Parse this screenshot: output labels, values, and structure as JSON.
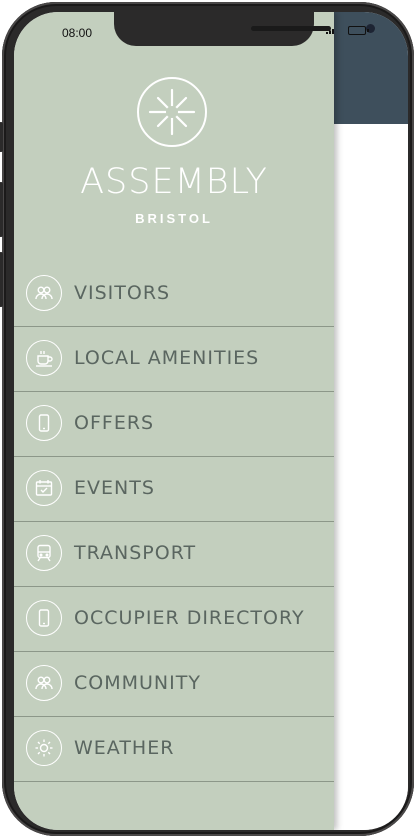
{
  "status_bar": {
    "time": "08:00"
  },
  "brand": {
    "name": "ASSEMBLY",
    "city": "BRISTOL"
  },
  "menu": {
    "items": [
      {
        "label": "VISITORS",
        "icon": "people-icon"
      },
      {
        "label": "LOCAL AMENITIES",
        "icon": "coffee-cup-icon"
      },
      {
        "label": "OFFERS",
        "icon": "phone-icon"
      },
      {
        "label": "EVENTS",
        "icon": "calendar-icon"
      },
      {
        "label": "TRANSPORT",
        "icon": "train-icon"
      },
      {
        "label": "OCCUPIER DIRECTORY",
        "icon": "phone-icon"
      },
      {
        "label": "COMMUNITY",
        "icon": "people-icon"
      },
      {
        "label": "WEATHER",
        "icon": "sun-icon"
      }
    ]
  },
  "colors": {
    "drawer": "#c3cfbe",
    "header": "#3e4f5c",
    "text": "#5a6660",
    "divider": "#8c9789"
  }
}
